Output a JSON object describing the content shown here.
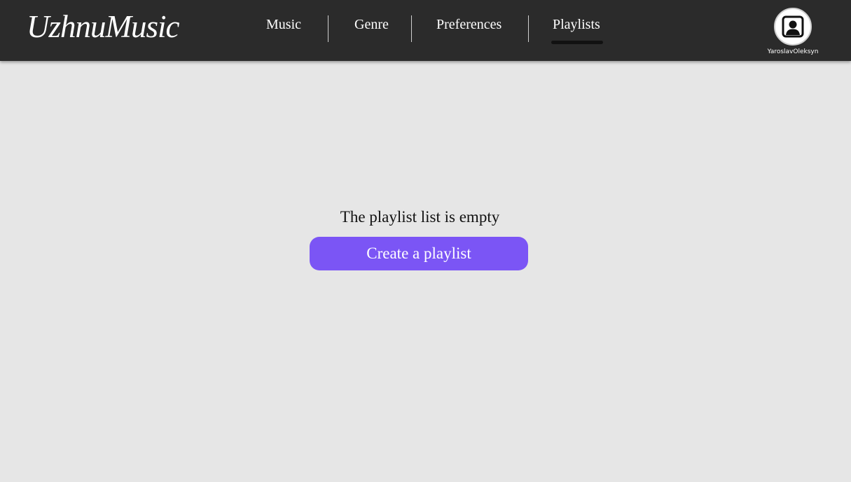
{
  "header": {
    "logo": "UzhnuMusic",
    "nav": [
      {
        "label": "Music"
      },
      {
        "label": "Genre"
      },
      {
        "label": "Preferences"
      },
      {
        "label": "Playlists",
        "active": true
      }
    ],
    "user": {
      "name": "YaroslavOleksyn",
      "icon": "user-portrait-icon"
    }
  },
  "main": {
    "empty_message": "The playlist list is empty",
    "create_button_label": "Create a playlist"
  },
  "colors": {
    "header_bg": "#2b2b2b",
    "page_bg": "#e6e6e6",
    "accent": "#7b55f5"
  }
}
